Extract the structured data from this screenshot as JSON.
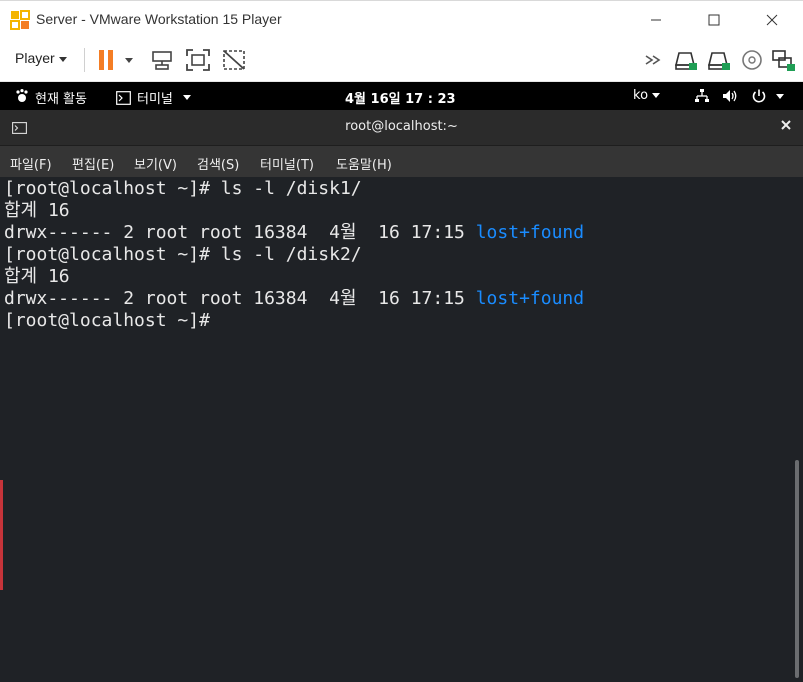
{
  "vmware": {
    "title": "Server - VMware Workstation 15 Player",
    "player_menu": "Player",
    "icons": [
      "vmware-player-logo-icon",
      "minimize-icon",
      "maximize-icon",
      "close-icon",
      "pause-icon",
      "dropdown-caret-icon",
      "send-ctrl-alt-del-icon",
      "fullscreen-icon",
      "unity-icon",
      "forward-icon",
      "hard-disk-1-icon",
      "hard-disk-2-icon",
      "cd-dvd-icon",
      "network-adapter-icon"
    ],
    "accent": "#f47d24"
  },
  "gnome": {
    "activities": "현재 활동",
    "app_menu": "터미널",
    "clock": "4월 16일  17 : 23",
    "input_method": "ko"
  },
  "terminal": {
    "title": "root@localhost:~",
    "menu": [
      "파일(F)",
      "편집(E)",
      "보기(V)",
      "검색(S)",
      "터미널(T)",
      "도움말(H)"
    ],
    "lines": [
      {
        "text": "[root@localhost ~]# ls -l /disk1/",
        "dir": ""
      },
      {
        "text": "합계 16",
        "dir": ""
      },
      {
        "text": "drwx------ 2 root root 16384  4월  16 17:15 ",
        "dir": "lost+found"
      },
      {
        "text": "[root@localhost ~]# ls -l /disk2/",
        "dir": ""
      },
      {
        "text": "합계 16",
        "dir": ""
      },
      {
        "text": "drwx------ 2 root root 16384  4월  16 17:15 ",
        "dir": "lost+found"
      },
      {
        "text": "[root@localhost ~]#",
        "dir": ""
      }
    ],
    "colors": {
      "background": "#1f2226",
      "foreground": "#e8e8e8",
      "directory": "#1a8cff"
    }
  }
}
